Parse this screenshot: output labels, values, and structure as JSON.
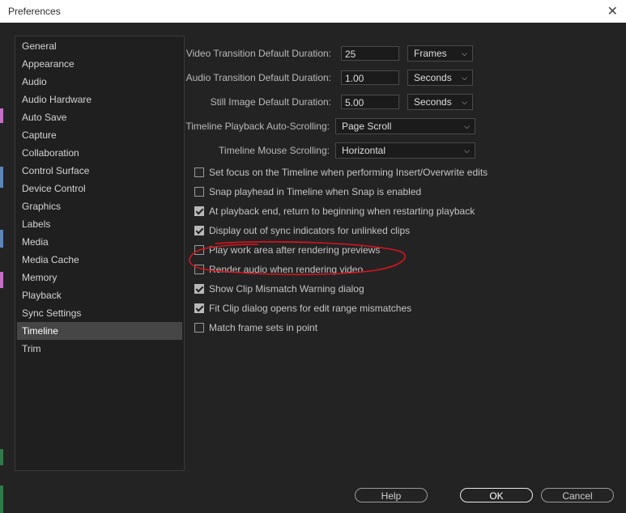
{
  "window": {
    "title": "Preferences"
  },
  "sidebar": {
    "items": [
      {
        "label": "General"
      },
      {
        "label": "Appearance"
      },
      {
        "label": "Audio"
      },
      {
        "label": "Audio Hardware"
      },
      {
        "label": "Auto Save"
      },
      {
        "label": "Capture"
      },
      {
        "label": "Collaboration"
      },
      {
        "label": "Control Surface"
      },
      {
        "label": "Device Control"
      },
      {
        "label": "Graphics"
      },
      {
        "label": "Labels"
      },
      {
        "label": "Media"
      },
      {
        "label": "Media Cache"
      },
      {
        "label": "Memory"
      },
      {
        "label": "Playback"
      },
      {
        "label": "Sync Settings"
      },
      {
        "label": "Timeline"
      },
      {
        "label": "Trim"
      }
    ],
    "selected": "Timeline"
  },
  "settings": {
    "video_transition": {
      "label": "Video Transition Default Duration:",
      "value": "25",
      "unit": "Frames"
    },
    "audio_transition": {
      "label": "Audio Transition Default Duration:",
      "value": "1.00",
      "unit": "Seconds"
    },
    "still_image": {
      "label": "Still Image Default Duration:",
      "value": "5.00",
      "unit": "Seconds"
    },
    "playback_scrolling": {
      "label": "Timeline Playback Auto-Scrolling:",
      "value": "Page Scroll"
    },
    "mouse_scrolling": {
      "label": "Timeline Mouse Scrolling:",
      "value": "Horizontal"
    }
  },
  "checkboxes": [
    {
      "label": "Set focus on the Timeline when performing Insert/Overwrite edits",
      "checked": false
    },
    {
      "label": "Snap playhead in Timeline when Snap is enabled",
      "checked": false
    },
    {
      "label": "At playback end, return to beginning when restarting playback",
      "checked": true
    },
    {
      "label": "Display out of sync indicators for unlinked clips",
      "checked": true
    },
    {
      "label": "Play work area after rendering previews",
      "checked": false
    },
    {
      "label": "Render audio when rendering video",
      "checked": false
    },
    {
      "label": "Show Clip Mismatch Warning dialog",
      "checked": true
    },
    {
      "label": "Fit Clip dialog opens for edit range mismatches",
      "checked": true
    },
    {
      "label": "Match frame sets in point",
      "checked": false
    }
  ],
  "buttons": {
    "help": "Help",
    "ok": "OK",
    "cancel": "Cancel"
  },
  "colors": {
    "annotation": "#d8141e",
    "background": "#232323",
    "selected": "#464646"
  }
}
